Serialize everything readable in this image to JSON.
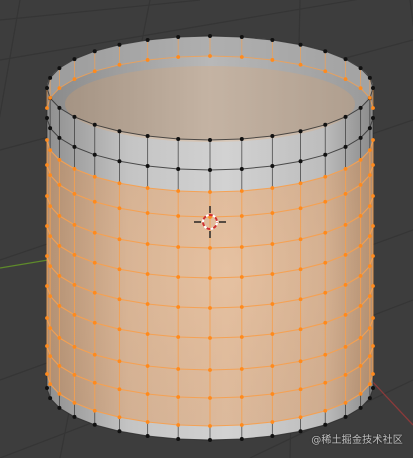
{
  "viewport": {
    "mode": "edit-mode",
    "object_type": "cylinder",
    "selection": "lower-and-middle-faces-selected"
  },
  "watermark": {
    "text": "@稀土掘金技术社区"
  },
  "colors": {
    "background": "#3d3d3d",
    "grid_line": "#353535",
    "axis_x": "#8a3a3a",
    "axis_y": "#5e8a2a",
    "mesh_face": "#b9b9b9",
    "selected_face_tint": "#f1a25a",
    "selected_edge": "#f5a050",
    "selected_vertex": "#ff8a1c",
    "unselected_edge": "#2a2a2a",
    "unselected_vertex": "#111111"
  },
  "icons": [
    "3d-cursor-icon"
  ]
}
